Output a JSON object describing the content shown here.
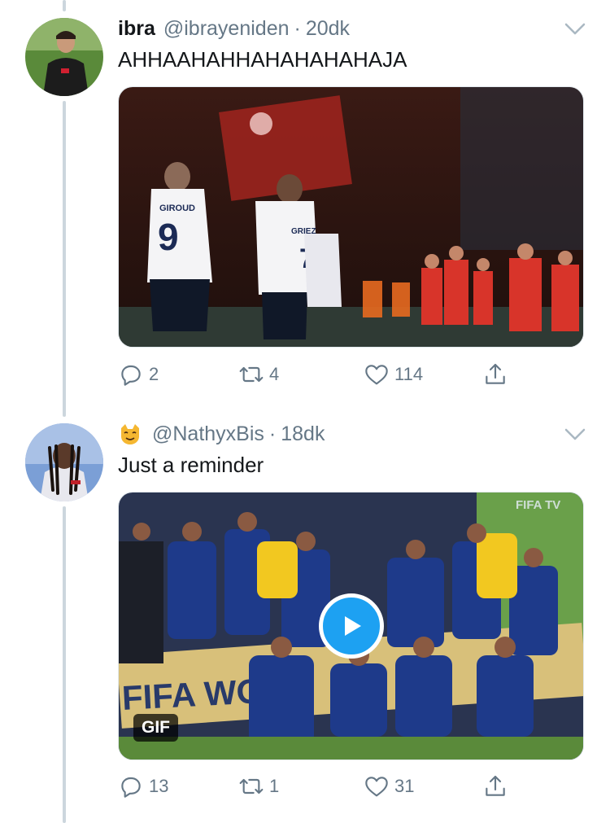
{
  "tweets": [
    {
      "name": "ibra",
      "handle": "@ibrayeniden",
      "separator": "·",
      "time": "20dk",
      "text": "AHHAAHAHHAHAHAHAHAJA",
      "media_type": "image",
      "media_label": "",
      "stats": {
        "replies": "2",
        "retweets": "4",
        "likes": "114"
      },
      "jersey_text": {
        "player1_name": "GIROUD",
        "player1_number": "9",
        "player2_name": "GRIEZ",
        "player2_number": "7"
      }
    },
    {
      "name": "",
      "name_icon": "cat-face-emoji-icon",
      "handle": "@NathyxBis",
      "separator": "·",
      "time": "18dk",
      "text": "Just a reminder",
      "media_type": "gif",
      "media_label": "GIF",
      "stats": {
        "replies": "13",
        "retweets": "1",
        "likes": "31"
      },
      "banner_text": "FIFA WO",
      "watermark_text": "FIFA TV"
    }
  ],
  "icons": {
    "reply": "reply-icon",
    "retweet": "retweet-icon",
    "like": "heart-icon",
    "share": "share-icon",
    "more": "chevron-down-icon",
    "play": "play-icon"
  },
  "colors": {
    "text_primary": "#14171a",
    "text_secondary": "#657786",
    "accent": "#1da1f2",
    "thread_line": "#ccd6dd"
  }
}
